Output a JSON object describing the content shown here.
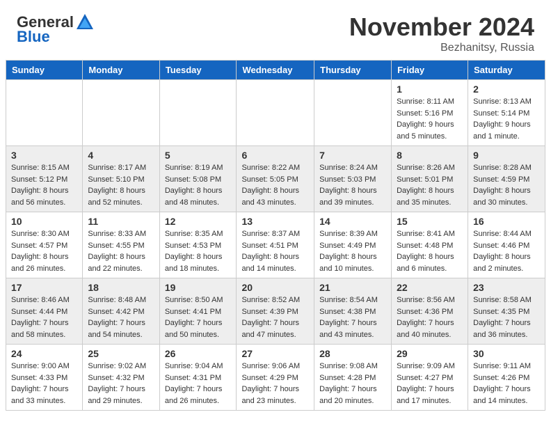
{
  "header": {
    "logo_general": "General",
    "logo_blue": "Blue",
    "month_title": "November 2024",
    "location": "Bezhanitsy, Russia"
  },
  "calendar": {
    "days_of_week": [
      "Sunday",
      "Monday",
      "Tuesday",
      "Wednesday",
      "Thursday",
      "Friday",
      "Saturday"
    ],
    "weeks": [
      [
        {
          "day": "",
          "info": ""
        },
        {
          "day": "",
          "info": ""
        },
        {
          "day": "",
          "info": ""
        },
        {
          "day": "",
          "info": ""
        },
        {
          "day": "",
          "info": ""
        },
        {
          "day": "1",
          "info": "Sunrise: 8:11 AM\nSunset: 5:16 PM\nDaylight: 9 hours\nand 5 minutes."
        },
        {
          "day": "2",
          "info": "Sunrise: 8:13 AM\nSunset: 5:14 PM\nDaylight: 9 hours\nand 1 minute."
        }
      ],
      [
        {
          "day": "3",
          "info": "Sunrise: 8:15 AM\nSunset: 5:12 PM\nDaylight: 8 hours\nand 56 minutes."
        },
        {
          "day": "4",
          "info": "Sunrise: 8:17 AM\nSunset: 5:10 PM\nDaylight: 8 hours\nand 52 minutes."
        },
        {
          "day": "5",
          "info": "Sunrise: 8:19 AM\nSunset: 5:08 PM\nDaylight: 8 hours\nand 48 minutes."
        },
        {
          "day": "6",
          "info": "Sunrise: 8:22 AM\nSunset: 5:05 PM\nDaylight: 8 hours\nand 43 minutes."
        },
        {
          "day": "7",
          "info": "Sunrise: 8:24 AM\nSunset: 5:03 PM\nDaylight: 8 hours\nand 39 minutes."
        },
        {
          "day": "8",
          "info": "Sunrise: 8:26 AM\nSunset: 5:01 PM\nDaylight: 8 hours\nand 35 minutes."
        },
        {
          "day": "9",
          "info": "Sunrise: 8:28 AM\nSunset: 4:59 PM\nDaylight: 8 hours\nand 30 minutes."
        }
      ],
      [
        {
          "day": "10",
          "info": "Sunrise: 8:30 AM\nSunset: 4:57 PM\nDaylight: 8 hours\nand 26 minutes."
        },
        {
          "day": "11",
          "info": "Sunrise: 8:33 AM\nSunset: 4:55 PM\nDaylight: 8 hours\nand 22 minutes."
        },
        {
          "day": "12",
          "info": "Sunrise: 8:35 AM\nSunset: 4:53 PM\nDaylight: 8 hours\nand 18 minutes."
        },
        {
          "day": "13",
          "info": "Sunrise: 8:37 AM\nSunset: 4:51 PM\nDaylight: 8 hours\nand 14 minutes."
        },
        {
          "day": "14",
          "info": "Sunrise: 8:39 AM\nSunset: 4:49 PM\nDaylight: 8 hours\nand 10 minutes."
        },
        {
          "day": "15",
          "info": "Sunrise: 8:41 AM\nSunset: 4:48 PM\nDaylight: 8 hours\nand 6 minutes."
        },
        {
          "day": "16",
          "info": "Sunrise: 8:44 AM\nSunset: 4:46 PM\nDaylight: 8 hours\nand 2 minutes."
        }
      ],
      [
        {
          "day": "17",
          "info": "Sunrise: 8:46 AM\nSunset: 4:44 PM\nDaylight: 7 hours\nand 58 minutes."
        },
        {
          "day": "18",
          "info": "Sunrise: 8:48 AM\nSunset: 4:42 PM\nDaylight: 7 hours\nand 54 minutes."
        },
        {
          "day": "19",
          "info": "Sunrise: 8:50 AM\nSunset: 4:41 PM\nDaylight: 7 hours\nand 50 minutes."
        },
        {
          "day": "20",
          "info": "Sunrise: 8:52 AM\nSunset: 4:39 PM\nDaylight: 7 hours\nand 47 minutes."
        },
        {
          "day": "21",
          "info": "Sunrise: 8:54 AM\nSunset: 4:38 PM\nDaylight: 7 hours\nand 43 minutes."
        },
        {
          "day": "22",
          "info": "Sunrise: 8:56 AM\nSunset: 4:36 PM\nDaylight: 7 hours\nand 40 minutes."
        },
        {
          "day": "23",
          "info": "Sunrise: 8:58 AM\nSunset: 4:35 PM\nDaylight: 7 hours\nand 36 minutes."
        }
      ],
      [
        {
          "day": "24",
          "info": "Sunrise: 9:00 AM\nSunset: 4:33 PM\nDaylight: 7 hours\nand 33 minutes."
        },
        {
          "day": "25",
          "info": "Sunrise: 9:02 AM\nSunset: 4:32 PM\nDaylight: 7 hours\nand 29 minutes."
        },
        {
          "day": "26",
          "info": "Sunrise: 9:04 AM\nSunset: 4:31 PM\nDaylight: 7 hours\nand 26 minutes."
        },
        {
          "day": "27",
          "info": "Sunrise: 9:06 AM\nSunset: 4:29 PM\nDaylight: 7 hours\nand 23 minutes."
        },
        {
          "day": "28",
          "info": "Sunrise: 9:08 AM\nSunset: 4:28 PM\nDaylight: 7 hours\nand 20 minutes."
        },
        {
          "day": "29",
          "info": "Sunrise: 9:09 AM\nSunset: 4:27 PM\nDaylight: 7 hours\nand 17 minutes."
        },
        {
          "day": "30",
          "info": "Sunrise: 9:11 AM\nSunset: 4:26 PM\nDaylight: 7 hours\nand 14 minutes."
        }
      ]
    ]
  }
}
